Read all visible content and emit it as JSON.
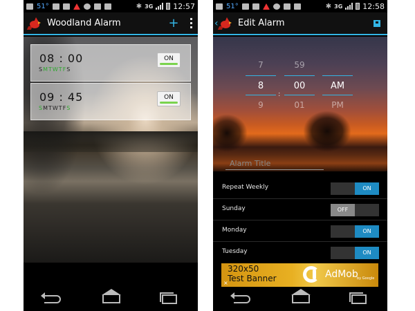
{
  "left": {
    "status": {
      "temp": "51°",
      "network": "3G",
      "time": "12:57"
    },
    "appbar": {
      "title": "Woodland Alarm",
      "add": "+"
    },
    "alarms": [
      {
        "time": "08 : 00",
        "days": [
          "S",
          "M",
          "T",
          "W",
          "T",
          "F",
          "S"
        ],
        "days_on": [
          false,
          true,
          true,
          true,
          true,
          true,
          false
        ],
        "toggle": "ON"
      },
      {
        "time": "09 : 45",
        "days": [
          "S",
          "M",
          "T",
          "W",
          "T",
          "F",
          "S"
        ],
        "days_on": [
          true,
          false,
          false,
          false,
          false,
          false,
          true
        ],
        "toggle": "ON"
      }
    ]
  },
  "right": {
    "status": {
      "temp": "51°",
      "network": "3G",
      "time": "12:58"
    },
    "appbar": {
      "title": "Edit Alarm",
      "back": "‹"
    },
    "picker": {
      "hour": {
        "prev": "7",
        "selected": "8",
        "next": "9"
      },
      "colon": ":",
      "minute": {
        "prev": "59",
        "selected": "00",
        "next": "01"
      },
      "ampm": {
        "prev": "",
        "selected": "AM",
        "next": "PM"
      }
    },
    "alarm_title_placeholder": "Alarm Title",
    "settings": [
      {
        "label": "Repeat Weekly",
        "state": "ON"
      },
      {
        "label": "Sunday",
        "state": "OFF"
      },
      {
        "label": "Monday",
        "state": "ON"
      },
      {
        "label": "Tuesday",
        "state": "ON"
      }
    ],
    "ad": {
      "line1": "320x50",
      "line2": "Test Banner",
      "close": "×",
      "brand": "AdMob",
      "by": "by Google"
    }
  },
  "colors": {
    "accent": "#33b5e5",
    "toggle_on": "#1e8bc3",
    "day_on": "#2ea82e"
  }
}
